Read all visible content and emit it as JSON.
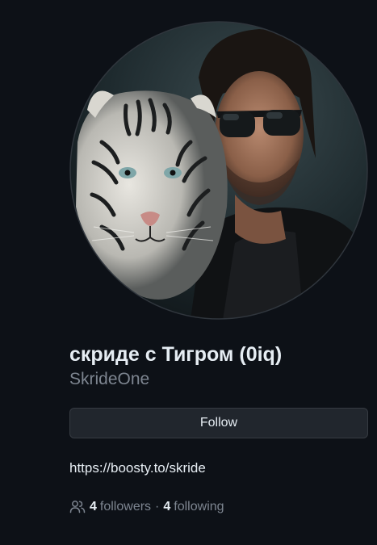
{
  "profile": {
    "avatar_icon": "avatar-photo-man-with-white-tiger",
    "display_name": "скриде с Тигром (0iq)",
    "username": "SkrideOne",
    "follow_button_label": "Follow",
    "link": "https://boosty.to/skride",
    "followers": {
      "icon": "people-icon",
      "count": "4",
      "label": "followers"
    },
    "separator": "·",
    "following": {
      "count": "4",
      "label": "following"
    }
  },
  "colors": {
    "background": "#0d1117",
    "text_primary": "#e6edf3",
    "text_muted": "#7d8590",
    "button_bg": "#21262d",
    "button_border": "#363b42"
  }
}
